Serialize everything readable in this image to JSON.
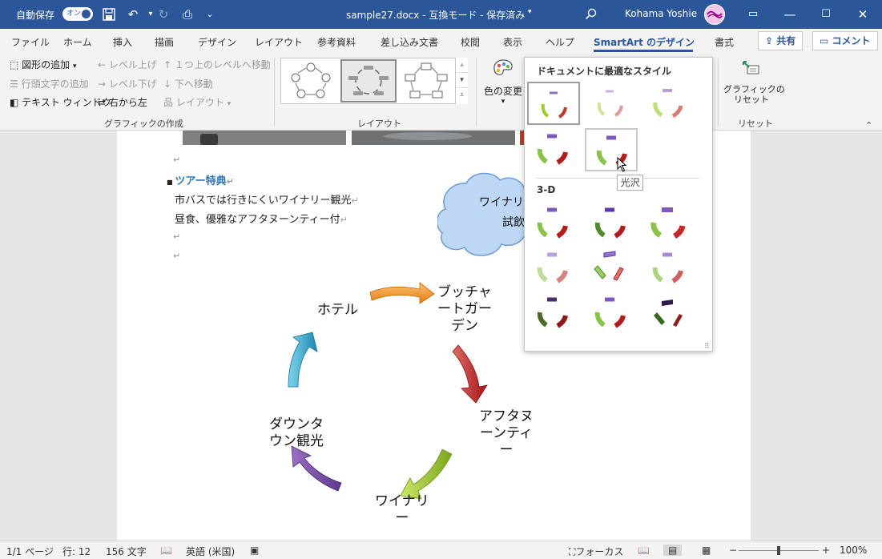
{
  "titlebar": {
    "autosave": "自動保存",
    "autosave_toggle": "オン",
    "doc_title": "sample27.docx  -  互換モード - 保存済み",
    "user": "Kohama Yoshie"
  },
  "tabs": [
    "ファイル",
    "ホーム",
    "挿入",
    "描画",
    "デザイン",
    "レイアウト",
    "参考資料",
    "差し込み文書",
    "校閲",
    "表示",
    "ヘルプ",
    "SmartArt のデザイン",
    "書式"
  ],
  "share_label": "共有",
  "comment_label": "コメント",
  "ribbon": {
    "create_graphic": {
      "add_shape": "図形の追加",
      "add_bullet": "行頭文字の追加",
      "text_pane": "テキスト ウィンドウ",
      "promote": "レベル上げ",
      "demote": "レベル下げ",
      "right_to_left": "右から左",
      "move_up": "１つ上のレベルへ移動",
      "move_down": "下へ移動",
      "layout": "レイアウト",
      "group": "グラフィックの作成"
    },
    "layouts_group": "レイアウト",
    "change_colors": "色の変更",
    "reset_graphic": "グラフィックの\nリセット",
    "reset_group": "リセット"
  },
  "styles_dropdown": {
    "header": "ドキュメントに最適なスタイル",
    "section_3d": "3-D",
    "tooltip": "光沢"
  },
  "document": {
    "heading": "ツアー特典",
    "lines": [
      "市バスでは行きにくいワイナリー観光",
      "昼食、優雅なアフタヌーンティー付"
    ],
    "cloud_lines": [
      "ワイナリ",
      "試飲"
    ],
    "nodes": {
      "hotel": "ホテル",
      "butchart": "ブッチャ\nートガー\nデン",
      "afternoon": "アフタヌ\nーンティ\nー",
      "winery": "ワイナリ\nー",
      "downtown": "ダウンタ\nウン観光"
    }
  },
  "statusbar": {
    "page": "1/1 ページ",
    "line": "行: 12",
    "chars": "156 文字",
    "lang": "英語 (米国)",
    "focus": "フォーカス",
    "zoom": "100%"
  },
  "colors": {
    "accent": "#2b579a"
  }
}
